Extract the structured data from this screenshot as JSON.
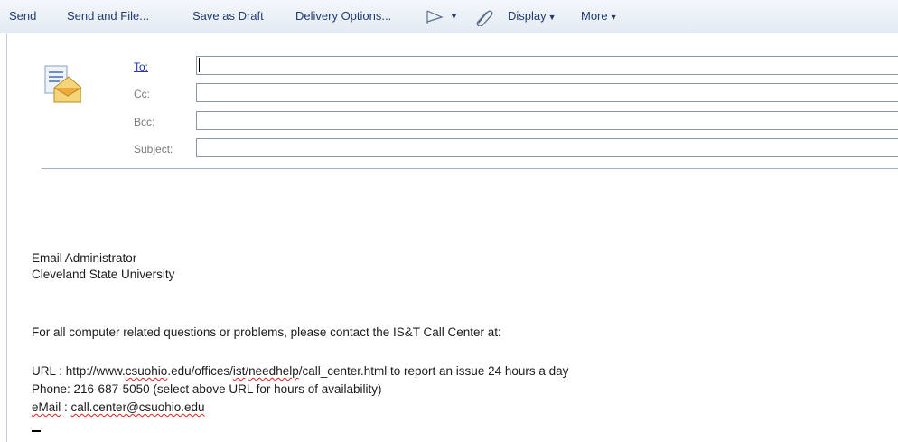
{
  "toolbar": {
    "send": "Send",
    "send_and_file": "Send and File...",
    "save_as_draft": "Save as Draft",
    "delivery_options": "Delivery Options...",
    "display": "Display",
    "more": "More",
    "dropdown_glyph": "▼",
    "flag_icon": "flag-outline-icon",
    "attach_icon": "paperclip-icon"
  },
  "header": {
    "icon": "envelope-memo-icon",
    "to_label": "To:",
    "cc_label": "Cc:",
    "bcc_label": "Bcc:",
    "subject_label": "Subject:",
    "to_value": "",
    "cc_value": "",
    "bcc_value": "",
    "subject_value": ""
  },
  "body": {
    "signature_line1": "Email Administrator",
    "signature_line2": "Cleveland State University",
    "contact_intro": "For all computer related questions or problems, please contact the IS&T Call Center at:",
    "url_label": "URL   : http://www.",
    "url_domain": "csuohio",
    "url_mid": ".edu/offices/",
    "url_ist": "ist",
    "url_slash": "/",
    "url_needhelp": "needhelp",
    "url_tail": "/call_center.html to report an issue 24 hours a day",
    "phone_line": "Phone: 216-687-5050 (select above URL for hours of availability)",
    "email_label": "eMail",
    "email_sep": " : ",
    "email_address": "call.center@csuohio.edu"
  },
  "colors": {
    "toolbar_text": "#1e3b70",
    "link_label": "#1a3bb3",
    "spell_underline": "#e02020",
    "field_border": "#8c96a4"
  }
}
